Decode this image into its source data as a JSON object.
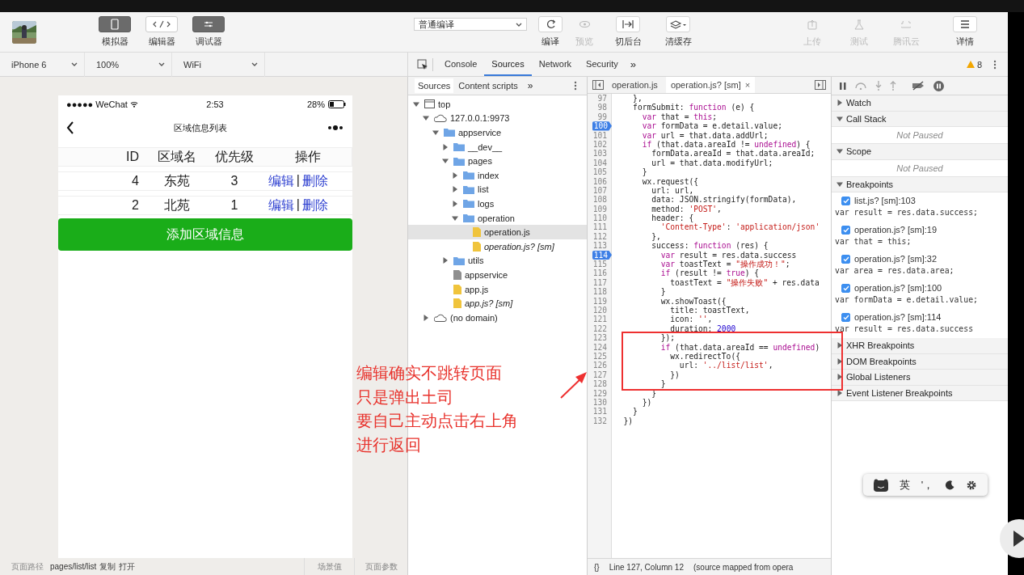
{
  "toolbar": {
    "left_buttons": [
      {
        "label": "模拟器",
        "selected": true
      },
      {
        "label": "编辑器",
        "selected": false
      },
      {
        "label": "调试器",
        "selected": true
      }
    ],
    "compile_mode": "普通编译",
    "actions": [
      {
        "label": "编译",
        "disabled": false
      },
      {
        "label": "预览",
        "disabled": true
      },
      {
        "label": "切后台",
        "disabled": false
      },
      {
        "label": "清缓存",
        "disabled": false
      }
    ],
    "right_actions": [
      {
        "label": "上传",
        "disabled": true
      },
      {
        "label": "测试",
        "disabled": true
      },
      {
        "label": "腾讯云",
        "disabled": true
      },
      {
        "label": "详情",
        "disabled": false
      }
    ]
  },
  "simulator_bar": {
    "device": "iPhone 6",
    "zoom": "100%",
    "network": "WiFi"
  },
  "devtools": {
    "tabs": [
      {
        "label": "Console",
        "selected": false
      },
      {
        "label": "Sources",
        "selected": true
      },
      {
        "label": "Network",
        "selected": false
      },
      {
        "label": "Security",
        "selected": false
      }
    ],
    "more": "»",
    "warnings": "8"
  },
  "phone": {
    "carrier": "●●●●● WeChat",
    "time": "2:53",
    "battery": "28%",
    "title": "区域信息列表",
    "columns": [
      "ID",
      "区域名",
      "优先级",
      "操作"
    ],
    "rows": [
      {
        "id": "4",
        "name": "东苑",
        "priority": "3",
        "edit": "编辑",
        "divider": "|",
        "delete": "删除"
      },
      {
        "id": "2",
        "name": "北苑",
        "priority": "1",
        "edit": "编辑",
        "divider": "|",
        "delete": "删除"
      }
    ],
    "add_button": "添加区域信息"
  },
  "bottom_bar": {
    "path_label": "页面路径",
    "path": "pages/list/list",
    "links": [
      "复制",
      "打开"
    ],
    "scene_label": "场景值",
    "params_label": "页面参数"
  },
  "navigator": {
    "tabs": [
      {
        "label": "Sources",
        "selected": true
      },
      {
        "label": "Content scripts",
        "selected": false
      }
    ],
    "more": "»",
    "tree": [
      {
        "label": "top",
        "kind": "frame",
        "expanded": true,
        "selected": false,
        "children": [
          {
            "label": "127.0.0.1:9973",
            "kind": "domain",
            "expanded": true,
            "selected": false,
            "children": [
              {
                "label": "appservice",
                "kind": "folder",
                "expanded": true,
                "selected": false,
                "children": [
                  {
                    "label": "__dev__",
                    "kind": "folder",
                    "expanded": false,
                    "selected": false
                  },
                  {
                    "label": "pages",
                    "kind": "folder",
                    "expanded": true,
                    "selected": false,
                    "children": [
                      {
                        "label": "index",
                        "kind": "folder",
                        "expanded": false,
                        "selected": false
                      },
                      {
                        "label": "list",
                        "kind": "folder",
                        "expanded": false,
                        "selected": false
                      },
                      {
                        "label": "logs",
                        "kind": "folder",
                        "expanded": false,
                        "selected": false
                      },
                      {
                        "label": "operation",
                        "kind": "folder",
                        "expanded": true,
                        "selected": false,
                        "children": [
                          {
                            "label": "operation.js",
                            "kind": "script",
                            "selected": true
                          },
                          {
                            "label": "operation.js? [sm]",
                            "kind": "sourcemap",
                            "selected": false
                          }
                        ]
                      }
                    ]
                  },
                  {
                    "label": "utils",
                    "kind": "folder",
                    "expanded": false,
                    "selected": false
                  },
                  {
                    "label": "appservice",
                    "kind": "document",
                    "selected": false
                  },
                  {
                    "label": "app.js",
                    "kind": "script",
                    "selected": false
                  },
                  {
                    "label": "app.js? [sm]",
                    "kind": "sourcemap",
                    "selected": false
                  }
                ]
              }
            ]
          },
          {
            "label": "(no domain)",
            "kind": "domain",
            "expanded": false,
            "selected": false
          }
        ]
      }
    ]
  },
  "editor": {
    "tabs": [
      {
        "label": "operation.js",
        "selected": false,
        "closable": false
      },
      {
        "label": "operation.js? [sm]",
        "selected": true,
        "closable": true
      }
    ],
    "close": "×",
    "lines": [
      {
        "n": "97",
        "code": "    },",
        "breakpoint": false
      },
      {
        "n": "98",
        "code": "    formSubmit: function (e) {",
        "breakpoint": false
      },
      {
        "n": "99",
        "code": "      var that = this;",
        "breakpoint": false
      },
      {
        "n": "100",
        "code": "      var formData = e.detail.value;",
        "breakpoint": true
      },
      {
        "n": "101",
        "code": "      var url = that.data.addUrl;",
        "breakpoint": false
      },
      {
        "n": "102",
        "code": "      if (that.data.areaId != undefined) {",
        "breakpoint": false
      },
      {
        "n": "103",
        "code": "        formData.areaId = that.data.areaId;",
        "breakpoint": false
      },
      {
        "n": "104",
        "code": "        url = that.data.modifyUrl;",
        "breakpoint": false
      },
      {
        "n": "105",
        "code": "      }",
        "breakpoint": false
      },
      {
        "n": "106",
        "code": "      wx.request({",
        "breakpoint": false
      },
      {
        "n": "107",
        "code": "        url: url,",
        "breakpoint": false
      },
      {
        "n": "108",
        "code": "        data: JSON.stringify(formData),",
        "breakpoint": false
      },
      {
        "n": "109",
        "code": "        method: 'POST',",
        "breakpoint": false
      },
      {
        "n": "110",
        "code": "        header: {",
        "breakpoint": false
      },
      {
        "n": "111",
        "code": "          'Content-Type': 'application/json'",
        "breakpoint": false
      },
      {
        "n": "112",
        "code": "        },",
        "breakpoint": false
      },
      {
        "n": "113",
        "code": "        success: function (res) {",
        "breakpoint": false
      },
      {
        "n": "114",
        "code": "          var result = res.data.success",
        "breakpoint": true
      },
      {
        "n": "115",
        "code": "          var toastText = \"操作成功！\";",
        "breakpoint": false
      },
      {
        "n": "116",
        "code": "          if (result != true) {",
        "breakpoint": false
      },
      {
        "n": "117",
        "code": "            toastText = \"操作失败\" + res.data",
        "breakpoint": false
      },
      {
        "n": "118",
        "code": "          }",
        "breakpoint": false
      },
      {
        "n": "119",
        "code": "          wx.showToast({",
        "breakpoint": false
      },
      {
        "n": "120",
        "code": "            title: toastText,",
        "breakpoint": false
      },
      {
        "n": "121",
        "code": "            icon: '',",
        "breakpoint": false
      },
      {
        "n": "122",
        "code": "            duration: 2000",
        "breakpoint": false
      },
      {
        "n": "123",
        "code": "          });",
        "breakpoint": false
      },
      {
        "n": "124",
        "code": "          if (that.data.areaId == undefined)",
        "breakpoint": false
      },
      {
        "n": "125",
        "code": "            wx.redirectTo({",
        "breakpoint": false
      },
      {
        "n": "126",
        "code": "              url: '../list/list',",
        "breakpoint": false
      },
      {
        "n": "127",
        "code": "            })",
        "breakpoint": false
      },
      {
        "n": "128",
        "code": "          }",
        "breakpoint": false
      },
      {
        "n": "129",
        "code": "        }",
        "breakpoint": false
      },
      {
        "n": "130",
        "code": "      })",
        "breakpoint": false
      },
      {
        "n": "131",
        "code": "    }",
        "breakpoint": false
      },
      {
        "n": "132",
        "code": "  })",
        "breakpoint": false
      }
    ],
    "status": {
      "braces": "{}",
      "position": "Line 127, Column 12",
      "note": "(source mapped from opera"
    }
  },
  "debugger": {
    "sections": [
      {
        "title": "Watch",
        "expanded": false
      },
      {
        "title": "Call Stack",
        "expanded": true,
        "message": "Not Paused"
      },
      {
        "title": "Scope",
        "expanded": true,
        "message": "Not Paused"
      },
      {
        "title": "Breakpoints",
        "expanded": true,
        "breakpoints": [
          {
            "location": "list.js? [sm]:103",
            "code": "var result = res.data.success;",
            "checked": true
          },
          {
            "location": "operation.js? [sm]:19",
            "code": "var that = this;",
            "checked": true
          },
          {
            "location": "operation.js? [sm]:32",
            "code": "var area = res.data.area;",
            "checked": true
          },
          {
            "location": "operation.js? [sm]:100",
            "code": "var formData = e.detail.value;",
            "checked": true
          },
          {
            "location": "operation.js? [sm]:114",
            "code": "var result = res.data.success",
            "checked": true
          }
        ]
      },
      {
        "title": "XHR Breakpoints",
        "expanded": false
      },
      {
        "title": "DOM Breakpoints",
        "expanded": false
      },
      {
        "title": "Global Listeners",
        "expanded": false
      },
      {
        "title": "Event Listener Breakpoints",
        "expanded": false
      }
    ]
  },
  "annotation": {
    "lines": [
      "编辑确实不跳转页面",
      "只是弹出土司",
      "要自己主动点击右上角",
      "进行返回"
    ]
  },
  "ime_bar": {
    "language": "英",
    "punctuation": "'，"
  }
}
